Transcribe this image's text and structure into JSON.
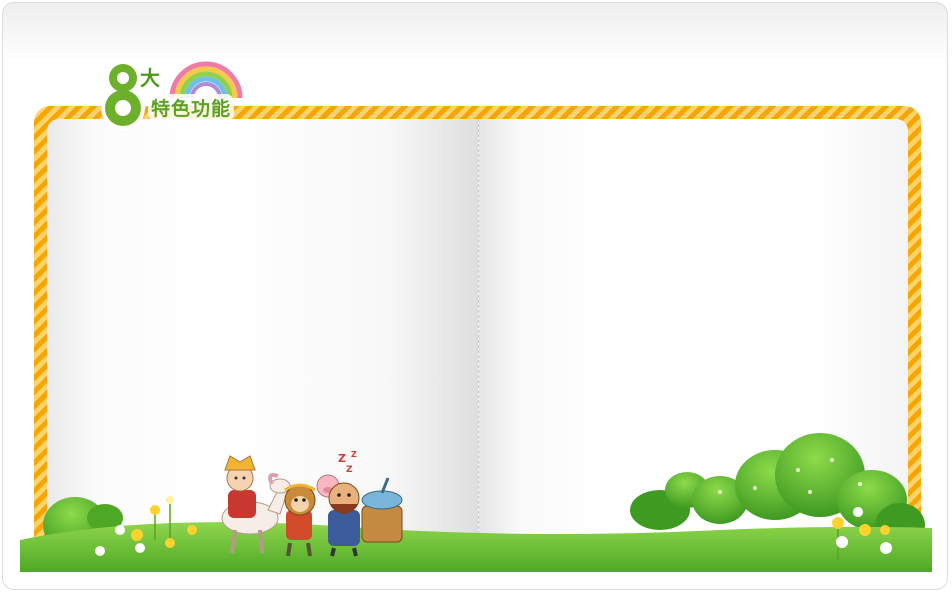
{
  "badge": {
    "number": "8",
    "top_text": "大",
    "bottom_text": "特色功能"
  },
  "colors": {
    "frame_stripe_dark": "#f7a600",
    "frame_stripe_light": "#ffd36b",
    "grass": "#6cc33a",
    "badge_green": "#5aa320"
  },
  "icons": {
    "rainbow": "rainbow-icon",
    "characters": "journey-to-the-west-characters-illustration",
    "sleep": "zzz-icon"
  }
}
